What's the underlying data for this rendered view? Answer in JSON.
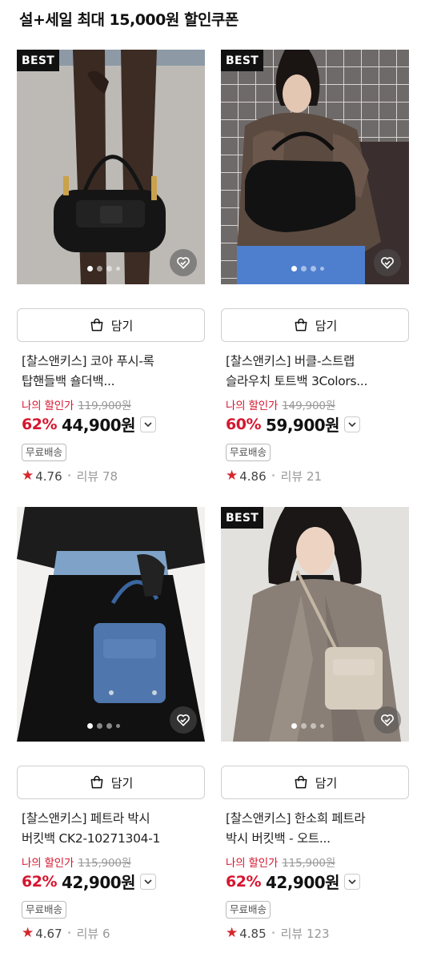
{
  "header": {
    "title": "설+세일 최대 15,000원 할인쿠폰"
  },
  "common": {
    "cart_label": "담기",
    "my_price_label": "나의 할인가",
    "shipping_badge": "무료배송",
    "review_prefix": "리뷰",
    "best_badge": "BEST",
    "accent_color": "#d6162f",
    "star_color": "#d6262d"
  },
  "products": [
    {
      "best": true,
      "name_line1": "[찰스앤키스] 코아 푸시-록",
      "name_line2": "탑핸들백 숄더백...",
      "original_price": "119,900원",
      "discount": "62%",
      "price": "44,900원",
      "rating": "4.76",
      "review_count": "78",
      "image_icon": "black-shoulder-bag-image"
    },
    {
      "best": true,
      "name_line1": "[찰스앤키스] 버클-스트랩",
      "name_line2": "슬라우치 토트백 3Colors...",
      "original_price": "149,900원",
      "discount": "60%",
      "price": "59,900원",
      "rating": "4.86",
      "review_count": "21",
      "image_icon": "black-slouch-tote-image"
    },
    {
      "best": false,
      "name_line1": "[찰스앤키스] 페트라 박시",
      "name_line2": "버킷백 CK2-10271304-1",
      "original_price": "115,900원",
      "discount": "62%",
      "price": "42,900원",
      "rating": "4.67",
      "review_count": "6",
      "image_icon": "denim-bucket-bag-image"
    },
    {
      "best": true,
      "name_line1": "[찰스앤키스] 한소희 페트라",
      "name_line2": "박시 버킷백 - 오트...",
      "original_price": "115,900원",
      "discount": "62%",
      "price": "42,900원",
      "rating": "4.85",
      "review_count": "123",
      "image_icon": "oat-bucket-bag-image"
    }
  ]
}
